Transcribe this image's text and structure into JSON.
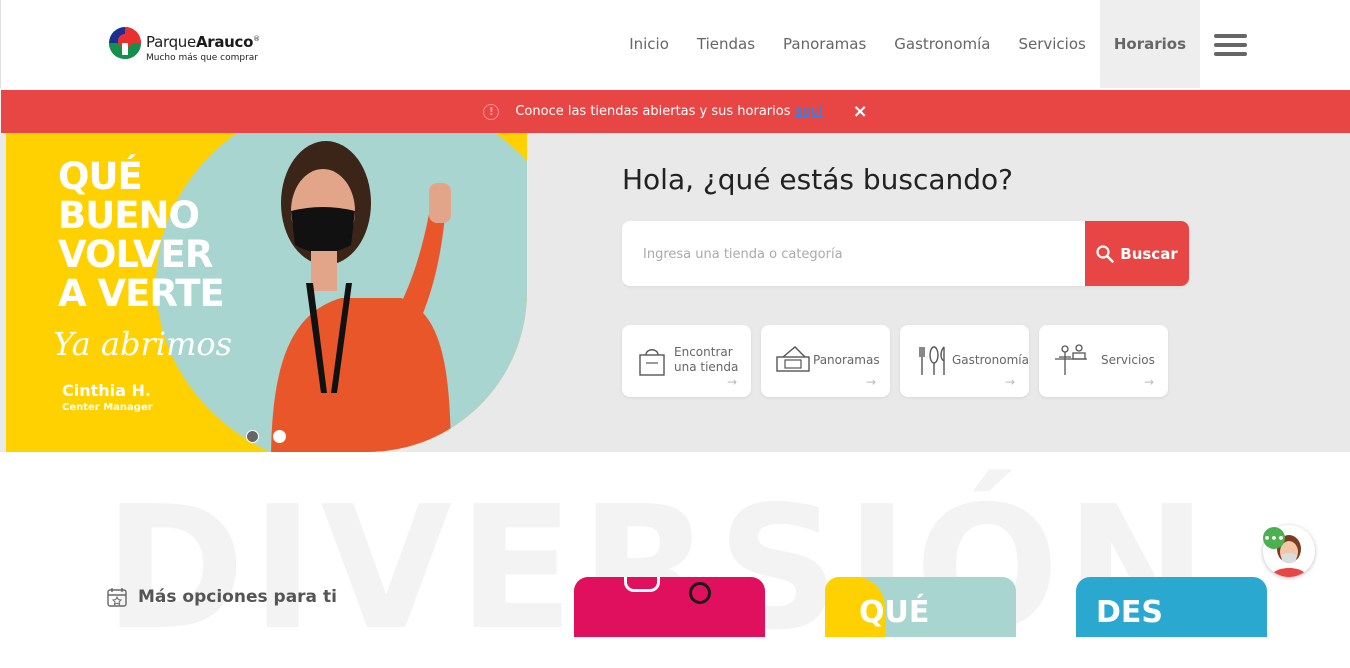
{
  "logo": {
    "brand_light": "Parque",
    "brand_bold": "Arauco",
    "registered": "®",
    "tagline": "Mucho más que comprar"
  },
  "nav": {
    "items": [
      {
        "label": "Inicio"
      },
      {
        "label": "Tiendas"
      },
      {
        "label": "Panoramas"
      },
      {
        "label": "Gastronomía"
      },
      {
        "label": "Servicios"
      },
      {
        "label": "Horarios",
        "active": true
      }
    ]
  },
  "alert": {
    "message": "Conoce las tiendas abiertas y sus horarios",
    "link": "aquí",
    "close": "×",
    "info_icon": "!"
  },
  "banner": {
    "title_lines": [
      "QUÉ",
      "BUENO",
      "VOLVER",
      "A VERTE"
    ],
    "script": "Ya abrimos",
    "person_name": "Cinthia H.",
    "person_role": "Center Manager",
    "slides": 2,
    "active_slide": 2
  },
  "search": {
    "title": "Hola, ¿qué estás buscando?",
    "placeholder": "Ingresa una tienda o categoría",
    "value": "",
    "button_label": "Buscar"
  },
  "categories": [
    {
      "label1": "Encontrar",
      "label2": "una tienda",
      "icon": "shopping-bag-icon"
    },
    {
      "label1": "Panoramas",
      "label2": "",
      "icon": "ticket-icon"
    },
    {
      "label1": "Gastronomía",
      "label2": "",
      "icon": "cutlery-icon"
    },
    {
      "label1": "Servicios",
      "label2": "",
      "icon": "service-desk-icon"
    }
  ],
  "section": {
    "background_word": "DIVERSIÓN",
    "options_title": "Más opciones para ti"
  },
  "tiles": [
    {
      "text": ""
    },
    {
      "text": "QUÉ"
    },
    {
      "text": "DES"
    }
  ],
  "chat": {
    "bubble": "•••"
  },
  "colors": {
    "accent": "#e84545",
    "yellow": "#ffd100",
    "teal": "#a8d5cf",
    "magenta": "#e0105e",
    "nav_active_bg": "#eeeeee"
  }
}
